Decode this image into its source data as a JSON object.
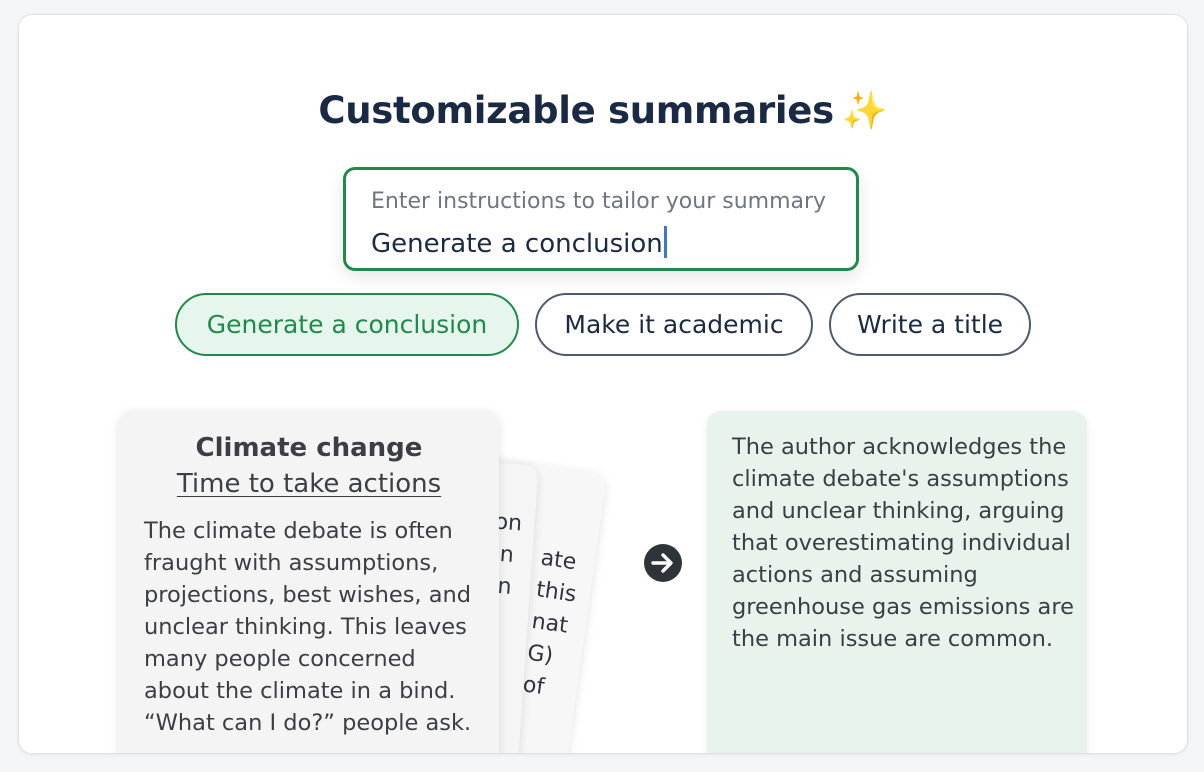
{
  "heading": {
    "title": "Customizable summaries",
    "sparkle": "✨"
  },
  "instructions": {
    "label": "Enter instructions to tailor your summary",
    "value": "Generate a conclusion"
  },
  "chips": [
    {
      "label": "Generate a conclusion",
      "active": true
    },
    {
      "label": "Make it academic",
      "active": false
    },
    {
      "label": "Write a title",
      "active": false
    }
  ],
  "source_doc": {
    "title": "Climate change",
    "subtitle": "Time to take actions",
    "body": "The climate debate is often fraught with assumptions, projections, best wishes, and unclear thinking. This leaves many people concerned about the climate in a bind. “What can I do?” people ask."
  },
  "back_cards": {
    "card2_lines": "ion\non\non\ns.\nf-\ne",
    "card3_lines": "ate\nthis\nnat\nG)\nof"
  },
  "result": {
    "text": "The author acknowledges the climate debate's assumptions and unclear thinking, arguing that overestimating individual actions and assuming greenhouse gas emissions are the main issue are common."
  },
  "icons": {
    "arrow": "arrow-right-circle-icon",
    "sparkle": "sparkles-icon"
  },
  "colors": {
    "accent_green": "#1e8a4c",
    "chip_active_bg": "#e6f6ec",
    "result_bg": "#e8f3eb",
    "title": "#1b2a44",
    "caret": "#3b79c9"
  }
}
